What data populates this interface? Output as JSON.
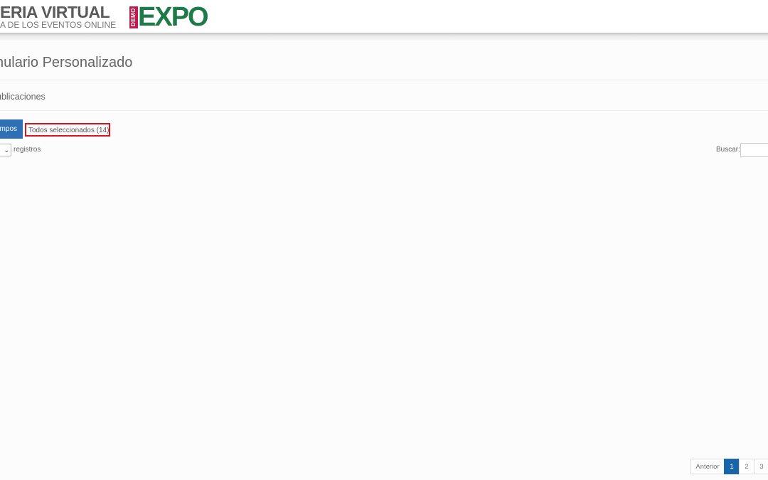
{
  "header": {
    "brand_title": "ERIA VIRTUAL",
    "brand_subtitle": "A DE LOS EVENTOS ONLINE",
    "logo_badge": "DEMO",
    "logo_text": "EXPO",
    "colors": {
      "logo_badge": "#c01a4e",
      "logo_text": "#1f7a4a"
    }
  },
  "page": {
    "title": "nulario Personalizado",
    "section": "ublicaciones"
  },
  "toolbar": {
    "columns_button": "mpos",
    "selected_label": "Todos seleccionados (14)",
    "length_suffix": "registros",
    "search_label": "Buscar:",
    "search_value": ""
  },
  "pagination": {
    "prev_label": "Anterior",
    "pages": [
      "1",
      "2",
      "3"
    ],
    "active_page": "1"
  },
  "colors": {
    "primary": "#2f6fb3",
    "highlight_border": "#e0121b"
  }
}
